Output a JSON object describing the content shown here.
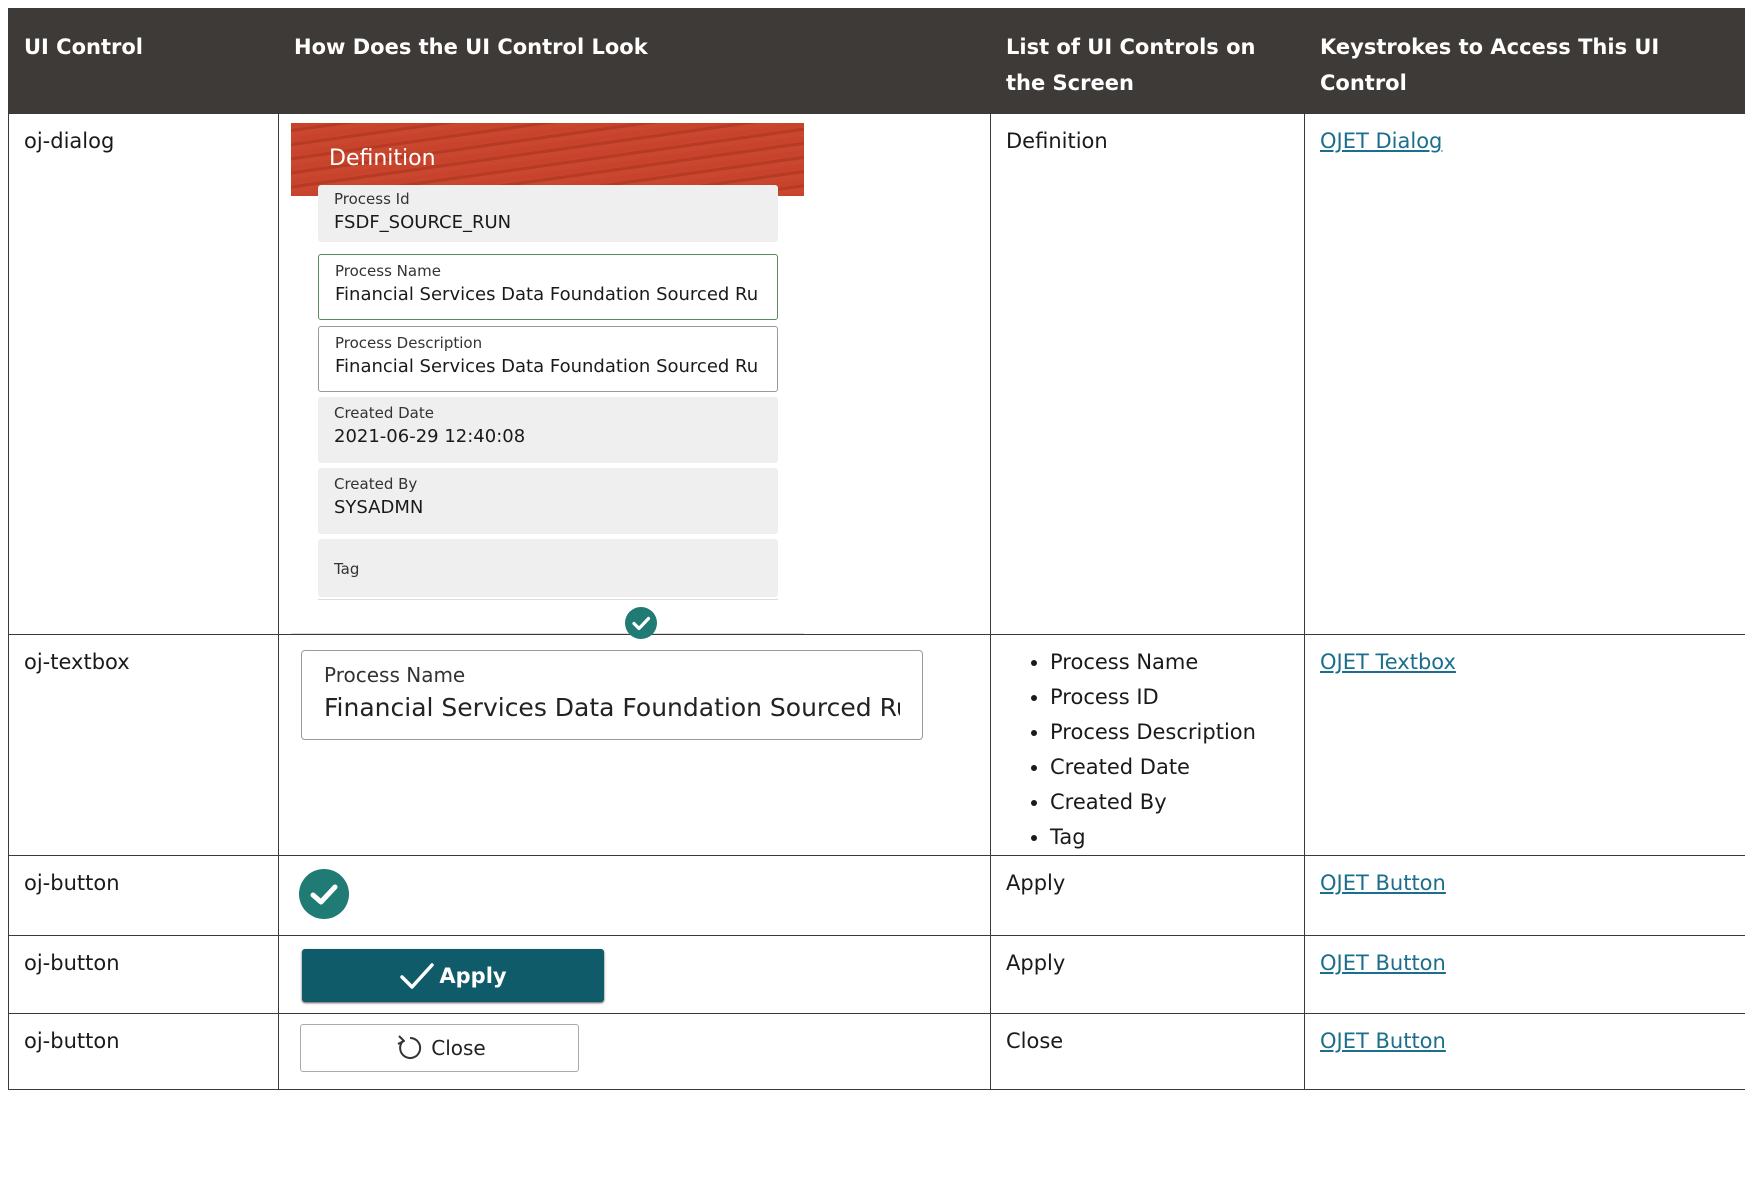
{
  "headers": {
    "col1": "UI Control",
    "col2": "How Does the UI Control Look",
    "col3": "List of UI Controls on the Screen",
    "col4": "Keystrokes to Access This UI Control"
  },
  "rows": [
    {
      "control": "oj-dialog",
      "controls_list": "Definition",
      "link": "OJET Dialog"
    },
    {
      "control": "oj-textbox",
      "controls_list": [
        "Process Name",
        "Process ID",
        "Process Description",
        "Created Date",
        "Created By",
        "Tag"
      ],
      "link": "OJET Textbox"
    },
    {
      "control": "oj-button",
      "controls_list": "Apply",
      "link": "OJET Button"
    },
    {
      "control": "oj-button",
      "controls_list": "Apply",
      "link": "OJET Button"
    },
    {
      "control": "oj-button",
      "controls_list": "Close",
      "link": "OJET Button"
    }
  ],
  "dialog": {
    "title": "Definition",
    "fields": [
      {
        "label": "Process Id",
        "value": "FSDF_SOURCE_RUN"
      },
      {
        "label": "Process Name",
        "value": "Financial Services Data Foundation Sourced Ru"
      },
      {
        "label": "Process Description",
        "value": "Financial Services Data Foundation Sourced Ru"
      },
      {
        "label": "Created Date",
        "value": "2021-06-29 12:40:08"
      },
      {
        "label": "Created By",
        "value": "SYSADMN"
      },
      {
        "label": "Tag",
        "value": ""
      }
    ]
  },
  "textbox": {
    "label": "Process Name",
    "value": "Financial Services Data Foundation Sourced Ru"
  },
  "buttons": {
    "apply_label": "Apply",
    "close_label": "Close"
  },
  "colors": {
    "header_bg": "#3d3a37",
    "dialog_header": "#c7432b",
    "teal": "#1f7b74",
    "apply_bg": "#105b69",
    "link": "#1b6e8c"
  },
  "icons": {
    "apply_icon": "check-circle-icon",
    "apply_button_icon": "check-icon",
    "close_button_icon": "reset-arrow-icon"
  }
}
